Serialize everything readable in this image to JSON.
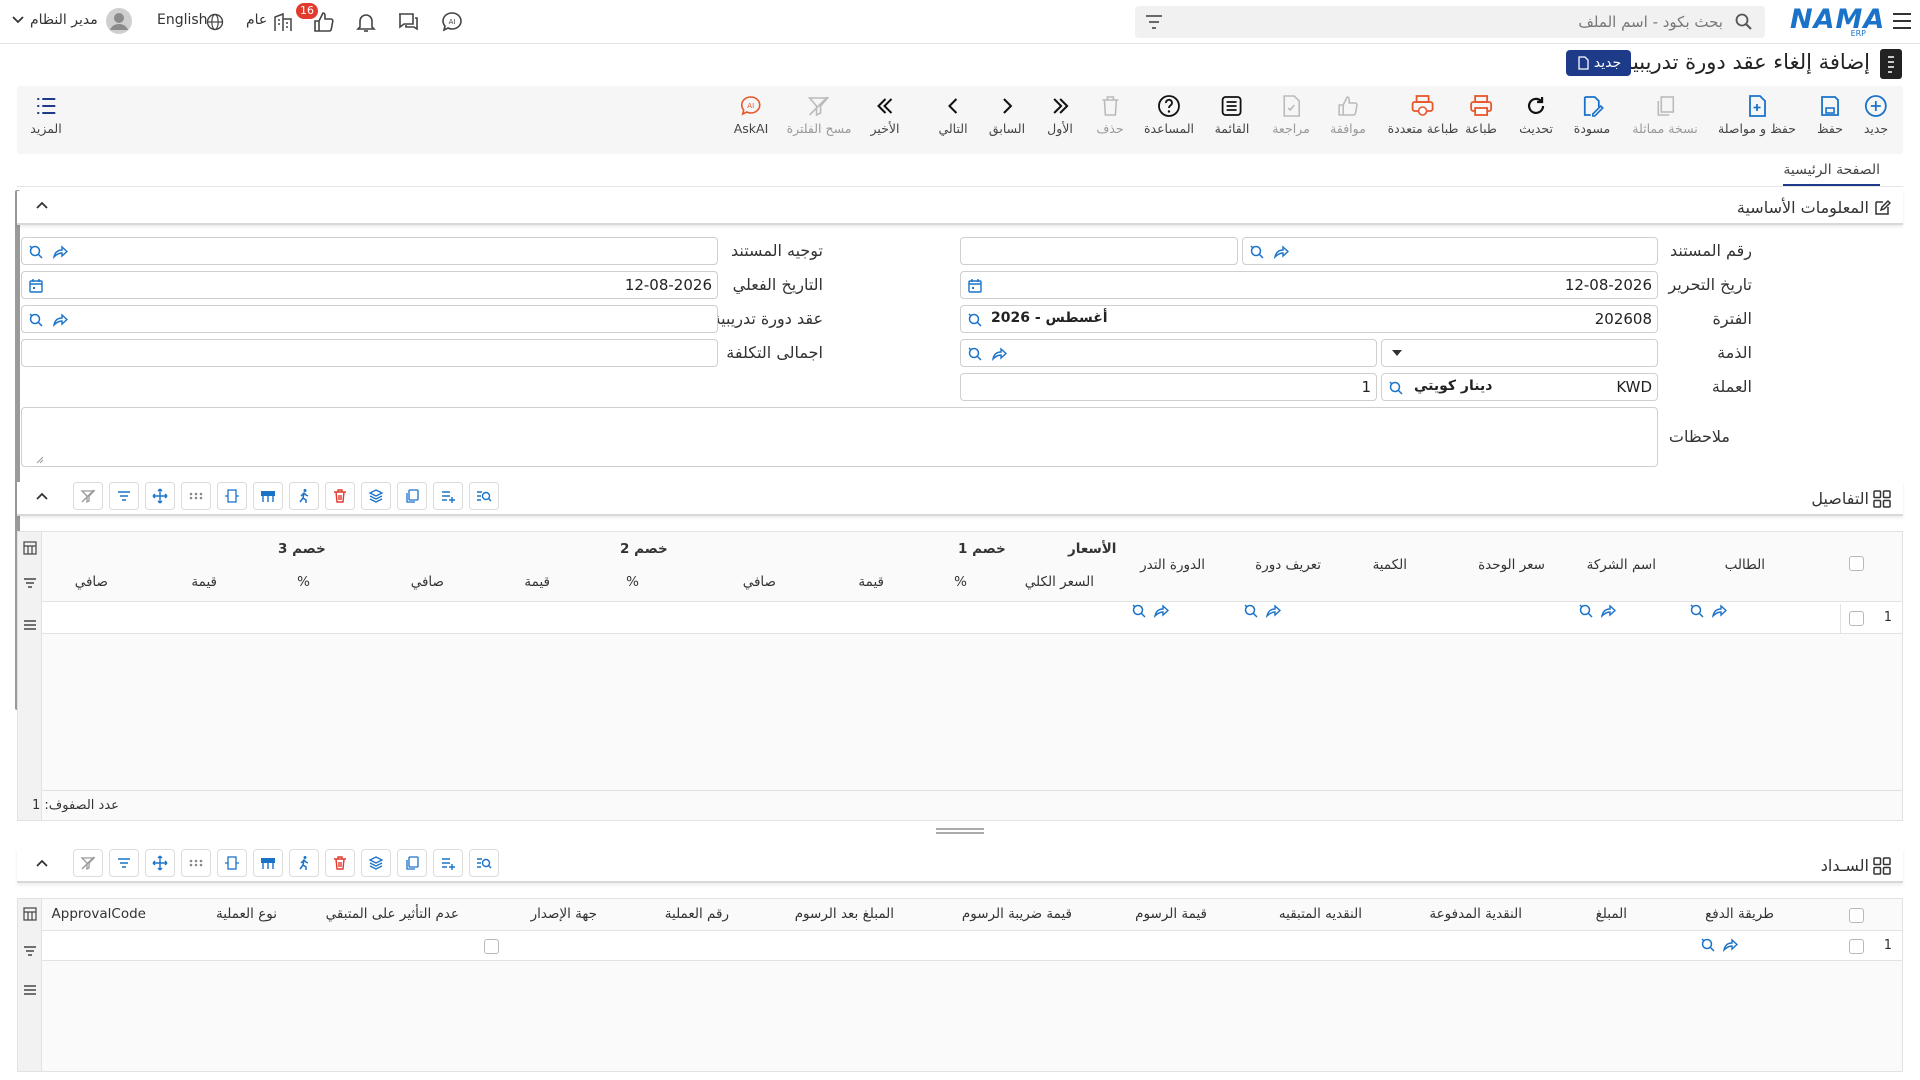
{
  "topbar": {
    "search_placeholder": "بحث بكود - اسم الملف",
    "logo_text": "NAMA",
    "logo_sub": "ERP",
    "user_name": "مدير النظام",
    "language": "English",
    "scope": "عام",
    "notifications_count": "16"
  },
  "page": {
    "title": "إضافة إلغاء عقد دورة تدريبية",
    "badge": "جديد"
  },
  "toolbar": {
    "items": [
      {
        "label": "جديد",
        "icon": "plus-circle-icon"
      },
      {
        "label": "حفظ",
        "icon": "save-icon"
      },
      {
        "label": "حفظ و مواصلة",
        "icon": "save-continue-icon"
      },
      {
        "label": "نسخة مماثلة",
        "icon": "copy-icon"
      },
      {
        "label": "مسودة",
        "icon": "draft-icon"
      },
      {
        "label": "تحديث",
        "icon": "refresh-icon"
      },
      {
        "label": "طباعة",
        "icon": "print-icon"
      },
      {
        "label": "طباعة متعددة",
        "icon": "multi-print-icon"
      },
      {
        "label": "موافقة",
        "icon": "thumbs-up-icon"
      },
      {
        "label": "مراجعة",
        "icon": "review-icon"
      },
      {
        "label": "القائمة",
        "icon": "list-icon"
      },
      {
        "label": "المساعدة",
        "icon": "help-icon"
      },
      {
        "label": "حذف",
        "icon": "trash-icon"
      },
      {
        "label": "الأول",
        "icon": "first-icon"
      },
      {
        "label": "السابق",
        "icon": "prev-icon"
      },
      {
        "label": "التالي",
        "icon": "next-icon"
      },
      {
        "label": "الأخير",
        "icon": "last-icon"
      },
      {
        "label": "مسح الفلترة",
        "icon": "clear-filter-icon"
      },
      {
        "label": "AskAI",
        "icon": "askai-icon"
      }
    ],
    "more_label": "المزيد"
  },
  "tabs": {
    "home": "الصفحة الرئيسية"
  },
  "basic_info": {
    "title": "المعلومات الأساسية",
    "doc_number_label": "رقم المستند",
    "doc_direction_label": "توجيه المستند",
    "edit_date_label": "تاريخ التحرير",
    "edit_date_value": "12-08-2026",
    "actual_date_label": "التاريخ الفعلي",
    "actual_date_value": "12-08-2026",
    "period_label": "الفترة",
    "period_code": "202608",
    "period_name": "2026 - أغسطس",
    "course_contract_label": "عقد دورة تدريبية",
    "liability_label": "الذمة",
    "total_cost_label": "اجمالى التكلفة",
    "currency_label": "العملة",
    "currency_code": "KWD",
    "currency_name": "دينار كويتي",
    "rate_value": "1",
    "notes_label": "ملاحظات"
  },
  "details": {
    "title": "التفاصيل",
    "group_prices": "الأسعار",
    "group_disc1": "خصم 1",
    "group_disc2": "خصم 2",
    "group_disc3": "خصم 3",
    "col_student": "الطالب",
    "col_company": "اسم الشركة",
    "col_unit_price": "سعر الوحدة",
    "col_qty": "الكمية",
    "col_course_def": "تعريف دورة",
    "col_course": "الدورة التدر",
    "col_total_price": "السعر الكلي",
    "col_pct": "%",
    "col_value": "قيمة",
    "col_net": "صافي",
    "row_number": "1",
    "row_count": "عدد الصفوف: 1"
  },
  "payment": {
    "title": "السـداد",
    "col_method": "طريقة الدفع",
    "col_amount": "المبلغ",
    "col_paid": "النقدية المدفوعة",
    "col_remaining": "النقديه المتبقيه",
    "col_fees": "قيمة الرسوم",
    "col_fee_tax": "قيمة ضريبة الرسوم",
    "col_after_fees": "المبلغ بعد الرسوم",
    "col_op_number": "رقم العملية",
    "col_issuer": "جهة الإصدار",
    "col_no_effect": "عدم التأثير على المتبقي",
    "col_op_type": "نوع العملية",
    "col_approval": "ApprovalCode",
    "row_number": "1"
  },
  "colors": {
    "primary": "#1e3b8a",
    "accent": "#1a73c9",
    "danger": "#e23b2e",
    "orange": "#e8572a"
  }
}
